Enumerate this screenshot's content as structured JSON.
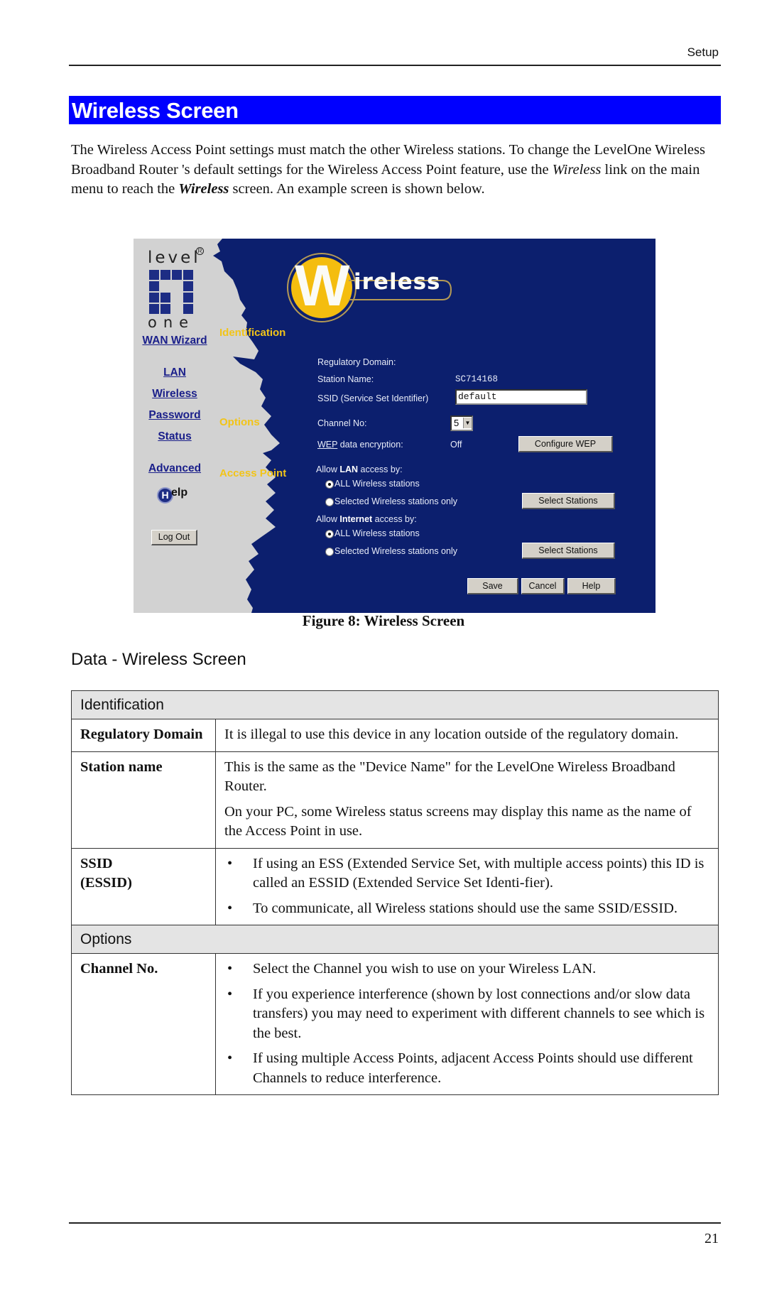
{
  "header": {
    "section": "Setup"
  },
  "title": "Wireless Screen",
  "intro": {
    "part1": "The Wireless Access Point settings must match the other Wireless stations. To change the LevelOne Wireless Broadband Router 's default settings for the Wireless Access Point feature, use the ",
    "link_italic": "Wireless",
    "part2": " link on the main menu to reach the ",
    "screen_bold": "Wireless",
    "part3": " screen. An example screen is shown below."
  },
  "figure": {
    "logo": {
      "top": "level",
      "bottom": "one",
      "reg": "R"
    },
    "banner": {
      "big_letter": "W",
      "rest": "ireless"
    },
    "nav": [
      {
        "label": "WAN Wizard"
      },
      {
        "label": "LAN"
      },
      {
        "label": "Wireless"
      },
      {
        "label": "Password"
      },
      {
        "label": "Status"
      },
      {
        "label": "Advanced"
      }
    ],
    "help_label": "elp",
    "help_letter": "H",
    "logout_label": "Log Out",
    "sections": {
      "identification": "Identification",
      "options": "Options",
      "access_point": "Access Point"
    },
    "form": {
      "regulatory_domain_label": "Regulatory Domain:",
      "station_name_label": "Station Name:",
      "station_name_value": "SC714168",
      "ssid_label": "SSID (Service Set Identifier)",
      "ssid_value": "default",
      "channel_label": "Channel No:",
      "channel_value": "5",
      "wep_link": "WEP",
      "wep_label_rest": " data encryption:",
      "wep_value": "Off",
      "configure_wep_button": "Configure WEP",
      "lan_access_prefix": "Allow ",
      "lan_access_bold": "LAN",
      "lan_access_suffix": " access by:",
      "internet_access_prefix": "Allow ",
      "internet_access_bold": "Internet",
      "internet_access_suffix": " access by:",
      "radio_all": "ALL Wireless stations",
      "radio_selected": "Selected Wireless stations only",
      "lan_selection": "all",
      "internet_selection": "all",
      "select_stations_button": "Select Stations",
      "save_button": "Save",
      "cancel_button": "Cancel",
      "help_button": "Help"
    }
  },
  "caption": "Figure 8: Wireless Screen",
  "data_heading": "Data - Wireless Screen",
  "table": {
    "sections": [
      {
        "title": "Identification",
        "rows": [
          {
            "label": "Regulatory Domain",
            "paragraphs": [
              "It is illegal to use this device in any location outside of the regulatory domain."
            ]
          },
          {
            "label": "Station name",
            "paragraphs": [
              "This is the same as the \"Device Name\" for the LevelOne Wireless Broadband Router.",
              "On your PC, some Wireless status screens may display this name as the name of the Access Point in use."
            ]
          },
          {
            "label": "SSID (ESSID)",
            "bullets": [
              "If using an ESS (Extended Service Set, with multiple access points) this ID is called an ESSID (Extended Service Set Identi-fier).",
              "To communicate, all Wireless stations should use the same SSID/ESSID."
            ]
          }
        ]
      },
      {
        "title": "Options",
        "rows": [
          {
            "label": "Channel No.",
            "bullets": [
              "Select the Channel you wish to use on your Wireless LAN.",
              "If you experience interference (shown by lost connections and/or slow data transfers) you may need to experiment with different channels to see which is the best.",
              "If using multiple Access Points, adjacent Access Points should use different Channels to reduce interference."
            ]
          }
        ]
      }
    ]
  },
  "footer": {
    "page_number": "21"
  },
  "colors": {
    "title_bar": "#0000ff",
    "figure_background": "#0c1f6e",
    "figure_sidebar": "#d2d2d2",
    "section_label": "#f2c418",
    "nav_link": "#1a1f8a",
    "table_section_bg": "#e4e4e4"
  }
}
